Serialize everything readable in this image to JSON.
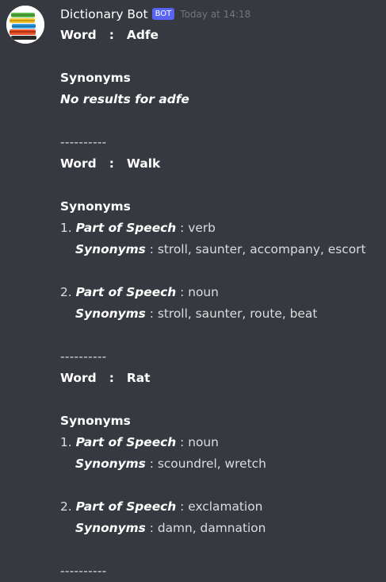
{
  "message": {
    "username": "Dictionary Bot",
    "badge": "BOT",
    "timestamp": "Today at 14:18",
    "avatar_icon": "stacked-books-icon"
  },
  "labels": {
    "word": "Word",
    "colon": ":",
    "synonyms_heading": "Synonyms",
    "part_of_speech": "Part of Speech",
    "synonyms_label": "Synonyms",
    "separator": "----------"
  },
  "entries": [
    {
      "word": "Adfe",
      "no_results": "No results for adfe"
    },
    {
      "word": "Walk",
      "senses": [
        {
          "num": "1.",
          "pos": "verb",
          "synonyms": "stroll, saunter, accompany, escort"
        },
        {
          "num": "2.",
          "pos": "noun",
          "synonyms": "stroll, saunter, route, beat"
        }
      ]
    },
    {
      "word": "Rat",
      "senses": [
        {
          "num": "1.",
          "pos": "noun",
          "synonyms": "scoundrel, wretch"
        },
        {
          "num": "2.",
          "pos": "exclamation",
          "synonyms": "damn, damnation"
        }
      ]
    }
  ]
}
